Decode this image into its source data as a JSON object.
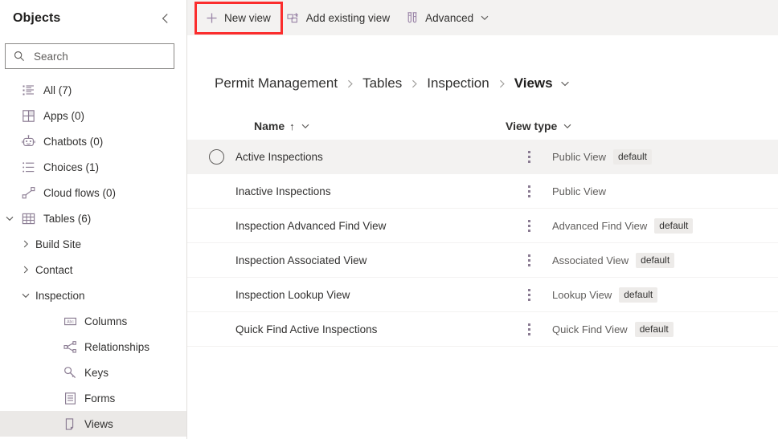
{
  "sidebar": {
    "title": "Objects",
    "collapse_icon": "chevron-left-icon",
    "search": {
      "placeholder": "Search",
      "value": "",
      "icon": "search-icon"
    },
    "items": [
      {
        "label": "All (7)",
        "icon": "list-all-icon",
        "level": 0,
        "chevron": "",
        "selected": false
      },
      {
        "label": "Apps (0)",
        "icon": "apps-grid-icon",
        "level": 0,
        "chevron": "",
        "selected": false
      },
      {
        "label": "Chatbots (0)",
        "icon": "chatbot-icon",
        "level": 0,
        "chevron": "",
        "selected": false
      },
      {
        "label": "Choices (1)",
        "icon": "choices-list-icon",
        "level": 0,
        "chevron": "",
        "selected": false
      },
      {
        "label": "Cloud flows (0)",
        "icon": "cloud-flow-icon",
        "level": 0,
        "chevron": "",
        "selected": false
      },
      {
        "label": "Tables (6)",
        "icon": "table-grid-icon",
        "level": 0,
        "chevron": "down",
        "selected": false
      },
      {
        "label": "Build Site",
        "icon": "",
        "level": 1,
        "chevron": "right",
        "selected": false
      },
      {
        "label": "Contact",
        "icon": "",
        "level": 1,
        "chevron": "right",
        "selected": false
      },
      {
        "label": "Inspection",
        "icon": "",
        "level": 1,
        "chevron": "down",
        "selected": false
      },
      {
        "label": "Columns",
        "icon": "columns-abc-icon",
        "level": 2,
        "chevron": "",
        "selected": false
      },
      {
        "label": "Relationships",
        "icon": "relationships-icon",
        "level": 2,
        "chevron": "",
        "selected": false
      },
      {
        "label": "Keys",
        "icon": "key-icon",
        "level": 2,
        "chevron": "",
        "selected": false
      },
      {
        "label": "Forms",
        "icon": "forms-icon",
        "level": 2,
        "chevron": "",
        "selected": false
      },
      {
        "label": "Views",
        "icon": "views-page-icon",
        "level": 2,
        "chevron": "",
        "selected": true
      }
    ]
  },
  "toolbar": {
    "new_view_label": "New view",
    "new_view_icon": "plus-icon",
    "add_existing_label": "Add existing view",
    "add_existing_icon": "add-existing-icon",
    "advanced_label": "Advanced",
    "advanced_icon": "test-tubes-icon",
    "advanced_caret": "chevron-down-icon",
    "highlight_color": "#fb2d2d",
    "background": "#f3f2f1"
  },
  "breadcrumb": {
    "items": [
      {
        "label": "Permit Management",
        "current": false
      },
      {
        "label": "Tables",
        "current": false
      },
      {
        "label": "Inspection",
        "current": false
      },
      {
        "label": "Views",
        "current": true
      }
    ],
    "separator": "chevron-right-icon",
    "trailing_caret": "chevron-down-icon"
  },
  "table": {
    "columns": [
      {
        "label": "Name",
        "sort": "↑",
        "caret": "chevron-down-icon"
      },
      {
        "label": "View type",
        "sort": "",
        "caret": "chevron-down-icon"
      }
    ],
    "default_badge_label": "default",
    "rows": [
      {
        "name": "Active Inspections",
        "type": "Public View",
        "default": true,
        "hovered": true,
        "radio": true
      },
      {
        "name": "Inactive Inspections",
        "type": "Public View",
        "default": false,
        "hovered": false,
        "radio": false
      },
      {
        "name": "Inspection Advanced Find View",
        "type": "Advanced Find View",
        "default": true,
        "hovered": false,
        "radio": false
      },
      {
        "name": "Inspection Associated View",
        "type": "Associated View",
        "default": true,
        "hovered": false,
        "radio": false
      },
      {
        "name": "Inspection Lookup View",
        "type": "Lookup View",
        "default": true,
        "hovered": false,
        "radio": false
      },
      {
        "name": "Quick Find Active Inspections",
        "type": "Quick Find View",
        "default": true,
        "hovered": false,
        "radio": false
      }
    ]
  }
}
